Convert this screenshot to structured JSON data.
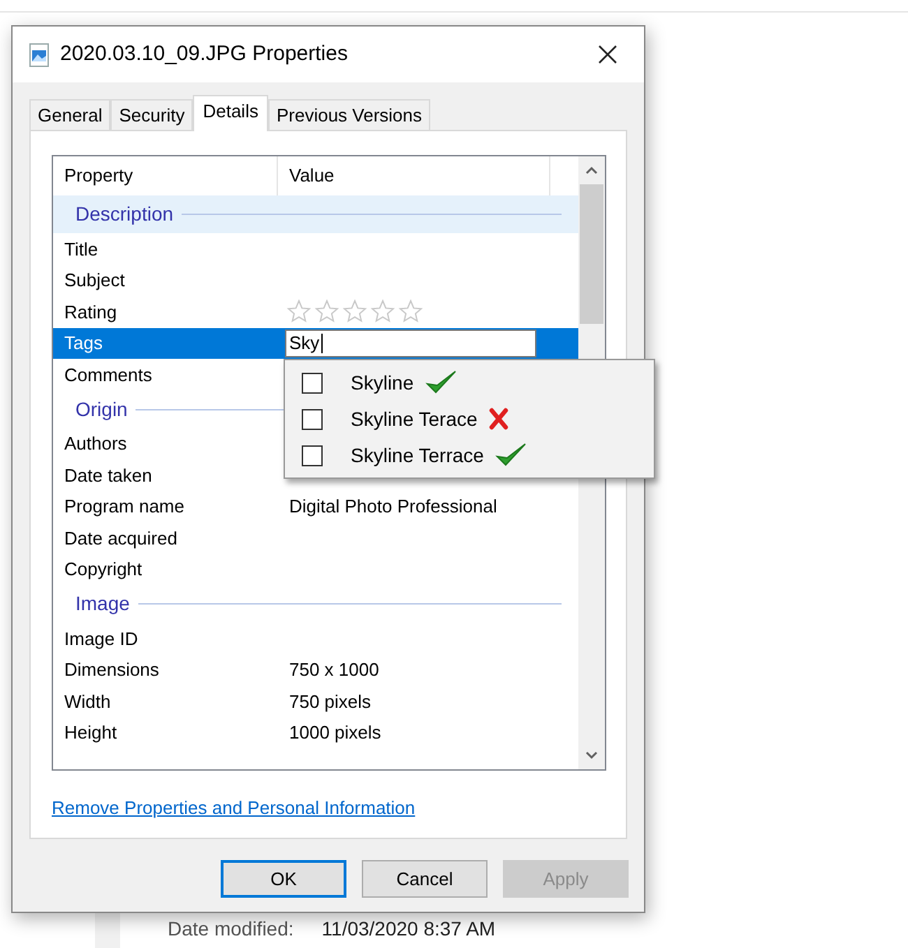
{
  "window": {
    "title": "2020.03.10_09.JPG Properties"
  },
  "tabs": [
    {
      "label": "General",
      "selected": false
    },
    {
      "label": "Security",
      "selected": false
    },
    {
      "label": "Details",
      "selected": true
    },
    {
      "label": "Previous Versions",
      "selected": false
    }
  ],
  "table": {
    "columns": [
      "Property",
      "Value"
    ],
    "sections": [
      {
        "title": "Description",
        "highlighted": true,
        "rows": [
          {
            "kind": "text",
            "property": "Title",
            "selected": false
          },
          {
            "kind": "text",
            "property": "Subject",
            "selected": false
          },
          {
            "kind": "stars",
            "property": "Rating",
            "stars": 0,
            "selected": false
          },
          {
            "kind": "editor",
            "property": "Tags",
            "value": "Sky",
            "selected": true
          },
          {
            "kind": "text",
            "property": "Comments",
            "selected": false
          }
        ]
      },
      {
        "title": "Origin",
        "highlighted": false,
        "rows": [
          {
            "kind": "text",
            "property": "Authors",
            "selected": false
          },
          {
            "kind": "text",
            "property": "Date taken",
            "selected": false
          },
          {
            "kind": "text",
            "property": "Program name",
            "value": "Digital Photo Professional",
            "selected": false
          },
          {
            "kind": "text",
            "property": "Date acquired",
            "selected": false
          },
          {
            "kind": "text",
            "property": "Copyright",
            "selected": false
          }
        ]
      },
      {
        "title": "Image",
        "highlighted": false,
        "rows": [
          {
            "kind": "text",
            "property": "Image ID",
            "selected": false
          },
          {
            "kind": "text",
            "property": "Dimensions",
            "value": "750 x 1000",
            "selected": false
          },
          {
            "kind": "text",
            "property": "Width",
            "value": "750 pixels",
            "selected": false
          },
          {
            "kind": "text",
            "property": "Height",
            "value": "1000 pixels",
            "selected": false
          }
        ]
      }
    ]
  },
  "suggestions": [
    {
      "label": "Skyline",
      "checked": false,
      "kind": "correct"
    },
    {
      "label": "Skyline Terace",
      "checked": false,
      "kind": "wrong"
    },
    {
      "label": "Skyline Terrace",
      "checked": false,
      "kind": "correct"
    }
  ],
  "link": "Remove Properties and Personal Information",
  "buttons": [
    {
      "label": "OK",
      "default": true,
      "disabled": false
    },
    {
      "label": "Cancel",
      "default": false,
      "disabled": false
    },
    {
      "label": "Apply",
      "default": false,
      "disabled": true
    }
  ],
  "background": {
    "label": "Date modified:",
    "value": "11/03/2020 8:37 AM"
  }
}
